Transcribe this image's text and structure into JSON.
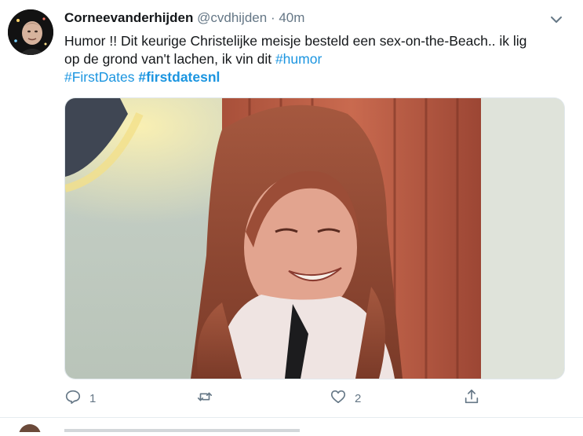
{
  "tweet": {
    "display_name": "Corneevanderhijden",
    "handle": "@cvdhijden",
    "separator": "·",
    "time": "40m",
    "text_line1": "Humor !! Dit keurige Christelijke meisje besteld een sex-on-the-Beach.. ik lig",
    "text_line2_prefix": "op de grond van't lachen, ik vin dit ",
    "hashtag_humor": "#humor",
    "hashtag_firstdates": "#FirstDates",
    "hashtag_firstdatesnl": "#firstdatesnl",
    "reply_count": "1",
    "retweet_count": "",
    "like_count": "2"
  },
  "icons": {
    "menu": "chevron-down-icon",
    "reply": "reply-icon",
    "retweet": "retweet-icon",
    "like": "heart-icon",
    "share": "share-icon"
  },
  "colors": {
    "link": "#1b95e0",
    "muted": "#657786",
    "text": "#14171a"
  }
}
